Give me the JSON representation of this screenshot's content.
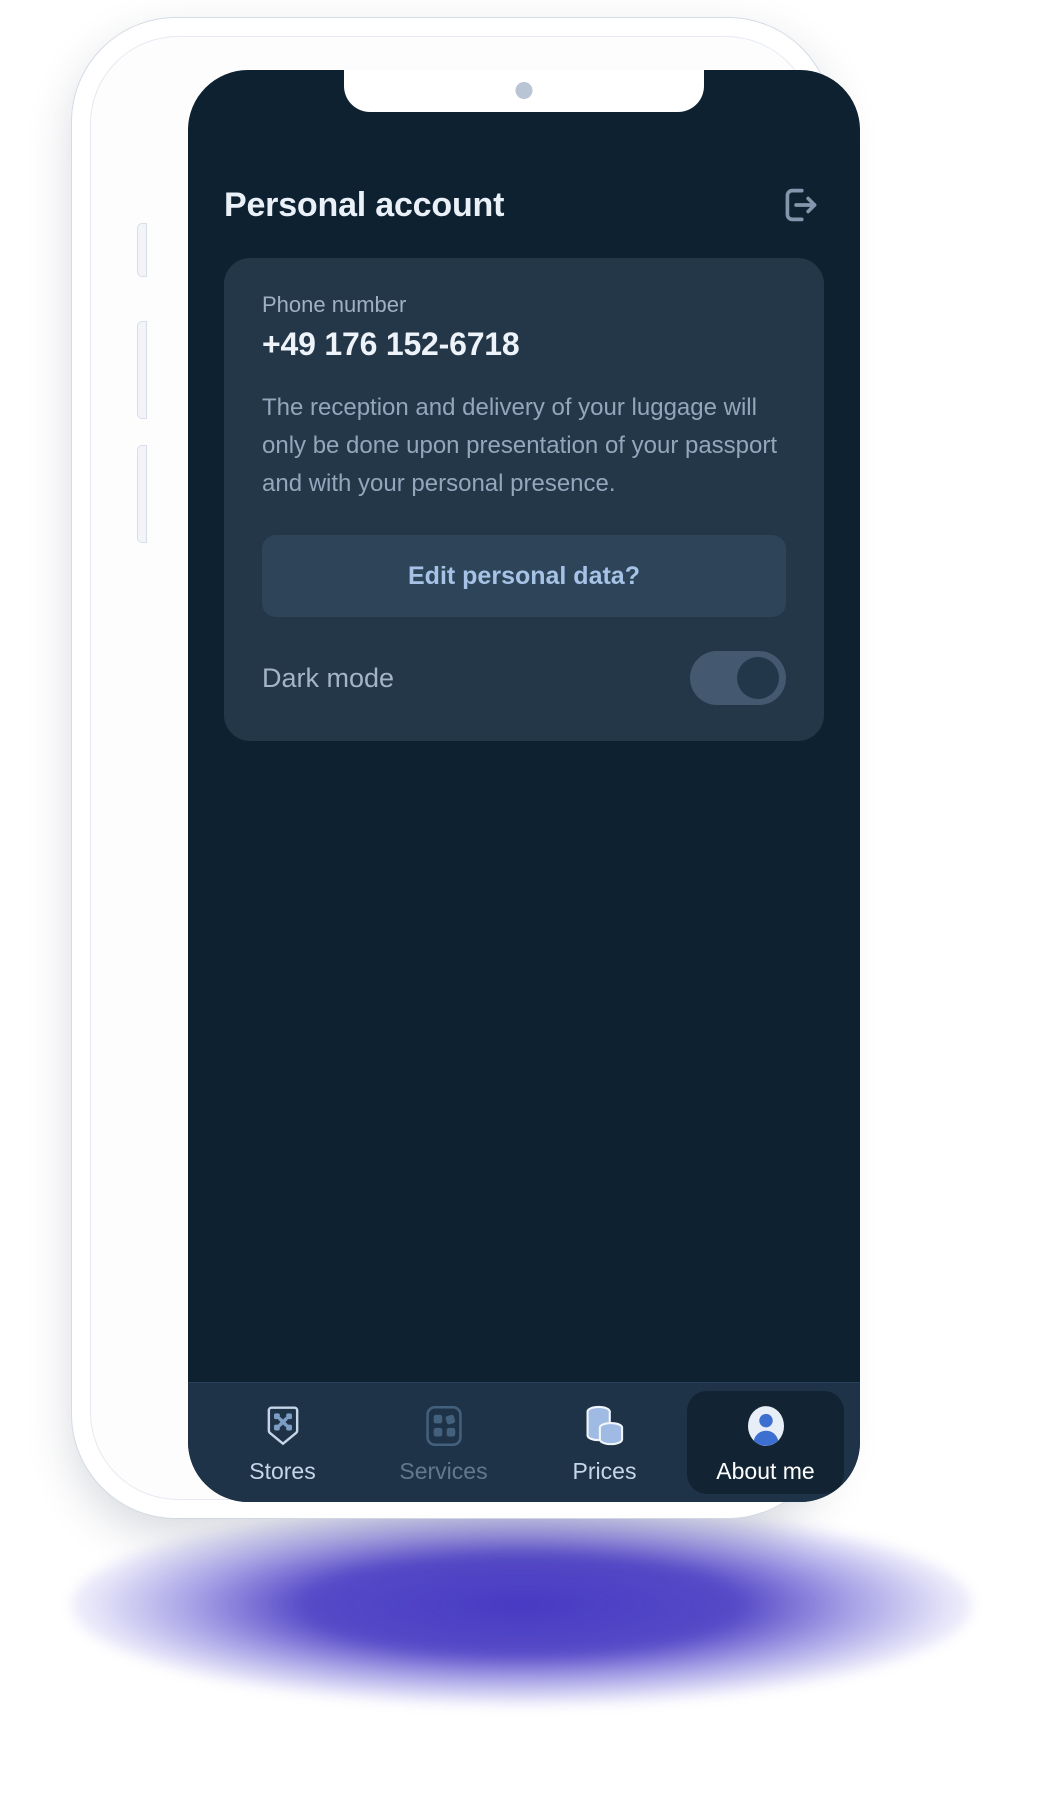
{
  "header": {
    "title": "Personal account",
    "logout_icon": "logout-icon"
  },
  "card": {
    "phone_label": "Phone number",
    "phone_value": "+49 176 152-6718",
    "description": "The reception and delivery of your luggage will only be done upon presentation of your passport and with your personal presence.",
    "edit_button": "Edit personal data?",
    "dark_mode_label": "Dark mode",
    "dark_mode_state": "on"
  },
  "bottom_nav": {
    "items": [
      {
        "label": "Stores",
        "icon": "shield-stores-icon",
        "state": "inactive"
      },
      {
        "label": "Services",
        "icon": "grid-services-icon",
        "state": "disabled"
      },
      {
        "label": "Prices",
        "icon": "coins-prices-icon",
        "state": "inactive"
      },
      {
        "label": "About me",
        "icon": "user-avatar-icon",
        "state": "active"
      }
    ]
  },
  "colors": {
    "screen_bg": "#0e2130",
    "card_bg": "#233749",
    "nav_bg": "#1e3347",
    "accent_text": "#a6c2e6",
    "active_pill": "#122433",
    "shadow_purple": "#382abe"
  }
}
